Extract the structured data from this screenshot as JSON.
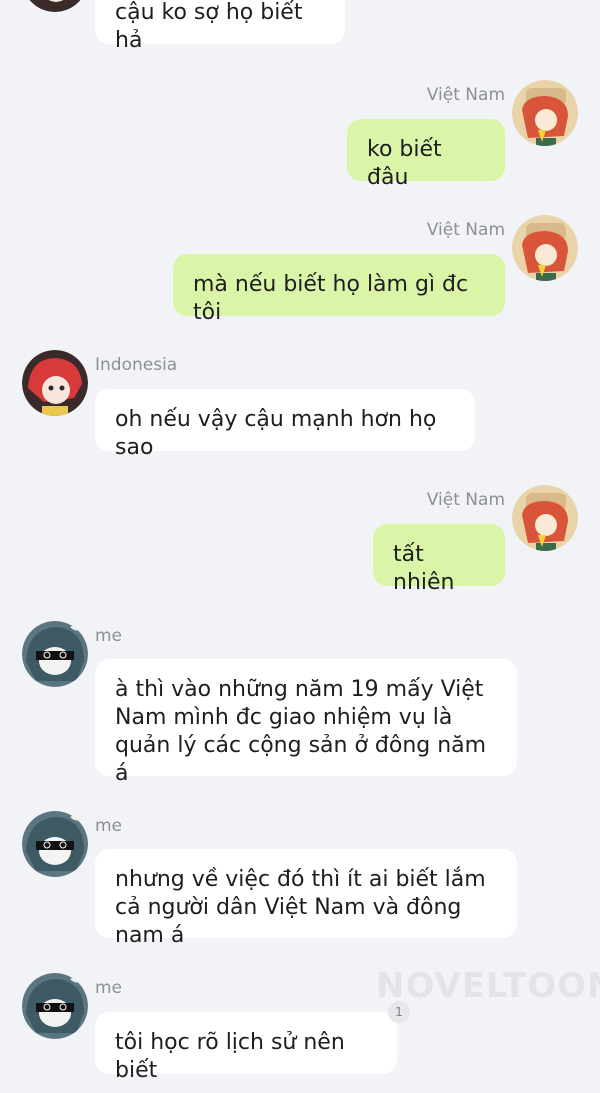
{
  "messages": [
    {
      "sender": "",
      "text": "cậu ko sợ họ biết hả"
    },
    {
      "sender": "Việt Nam",
      "text": "ko biết đâu"
    },
    {
      "sender": "Việt Nam",
      "text": "mà nếu biết họ làm gì đc tôi"
    },
    {
      "sender": "Indonesia",
      "text": "oh nếu vậy cậu mạnh hơn họ sao"
    },
    {
      "sender": "Việt Nam",
      "text": "tất nhiên"
    },
    {
      "sender": "me",
      "text": "à thì vào những năm 19 mấy Việt Nam mình đc giao nhiệm vụ là quản lý các cộng sản ở đông năm á"
    },
    {
      "sender": "me",
      "text": "nhưng về việc đó thì ít ai biết lắm cả người dân Việt Nam và đông nam á"
    },
    {
      "sender": "me",
      "text": "tôi học rõ lịch sử nên biết",
      "badge": "1"
    }
  ],
  "watermark": "NOVELTOON",
  "colors": {
    "background": "#f2f3f7",
    "bubble_left": "#ffffff",
    "bubble_right": "#dbf5a8"
  }
}
